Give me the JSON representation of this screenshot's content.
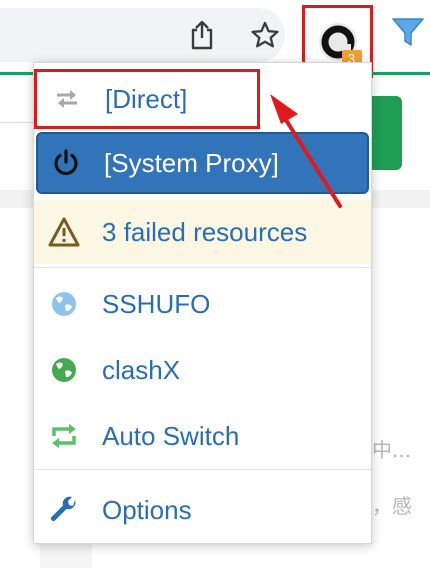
{
  "toolbar": {
    "extension_badge": "3",
    "icons": {
      "share": "share-icon",
      "bookmark": "star-icon",
      "extension": "switchyomega-icon",
      "filter": "filter-icon"
    },
    "accent_color": "#1aa260"
  },
  "menu": {
    "items": [
      {
        "label": "[Direct]",
        "icon": "transfer-arrows-icon",
        "state": "highlighted-by-annotation"
      },
      {
        "label": "[System Proxy]",
        "icon": "power-icon",
        "state": "selected"
      },
      {
        "label": "3 failed resources",
        "icon": "warning-icon",
        "state": "warning"
      },
      {
        "label": "SSHUFO",
        "icon": "globe-icon"
      },
      {
        "label": "clashX",
        "icon": "globe-icon"
      },
      {
        "label": "Auto Switch",
        "icon": "refresh-icon"
      },
      {
        "label": "Options",
        "icon": "wrench-icon"
      }
    ],
    "colors": {
      "link": "#2a6db5",
      "selected_bg": "#3274b9",
      "warning_bg": "#fcf7e3",
      "annotation": "#e0191b"
    }
  },
  "background_page": {
    "snippets": [
      "中...",
      "，感"
    ]
  }
}
